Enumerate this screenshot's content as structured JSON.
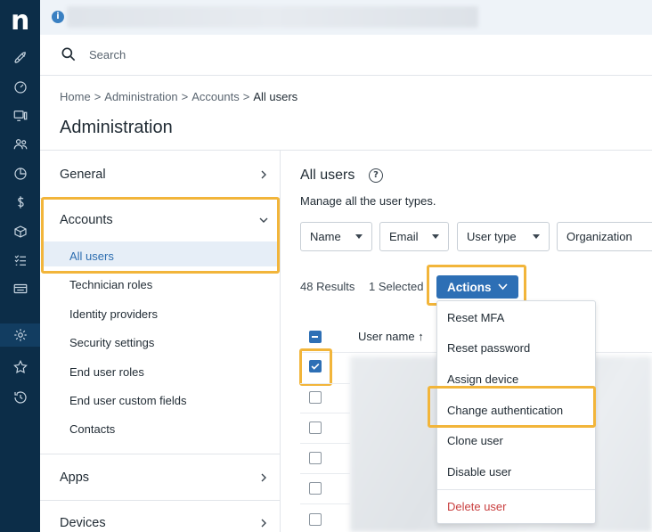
{
  "rail": {
    "logo": "n",
    "icons": [
      "rocket-icon",
      "dashboard-icon",
      "devices-icon",
      "users-icon",
      "chart-icon",
      "dollar-icon",
      "box-icon",
      "checklist-icon",
      "ticket-icon",
      "gear-icon",
      "star-icon",
      "history-icon"
    ]
  },
  "banner": {
    "info_icon": "i"
  },
  "search": {
    "placeholder": "Search"
  },
  "breadcrumb": {
    "items": [
      "Home",
      "Administration",
      "Accounts"
    ],
    "current": "All users",
    "separator": ">"
  },
  "page_title": "Administration",
  "left_nav": {
    "general": "General",
    "accounts": "Accounts",
    "sub_items": [
      "All users",
      "Technician roles",
      "Identity providers",
      "Security settings",
      "End user roles",
      "End user custom fields",
      "Contacts"
    ],
    "apps": "Apps",
    "devices": "Devices"
  },
  "main": {
    "title": "All users",
    "help": "?",
    "description": "Manage all the user types.",
    "filters": [
      "Name",
      "Email",
      "User type",
      "Organization"
    ],
    "results": "48 Results",
    "selected": "1 Selected",
    "actions_label": "Actions",
    "column_user_name": "User name",
    "sort_arrow": "↑"
  },
  "actions_menu": {
    "items": [
      "Reset MFA",
      "Reset password",
      "Assign device",
      "Change authentication",
      "Clone user",
      "Disable user"
    ],
    "danger_item": "Delete user"
  },
  "colors": {
    "rail_bg": "#0c2d48",
    "accent": "#2d6fb5",
    "highlight": "#f2b53a",
    "danger": "#c94040"
  }
}
